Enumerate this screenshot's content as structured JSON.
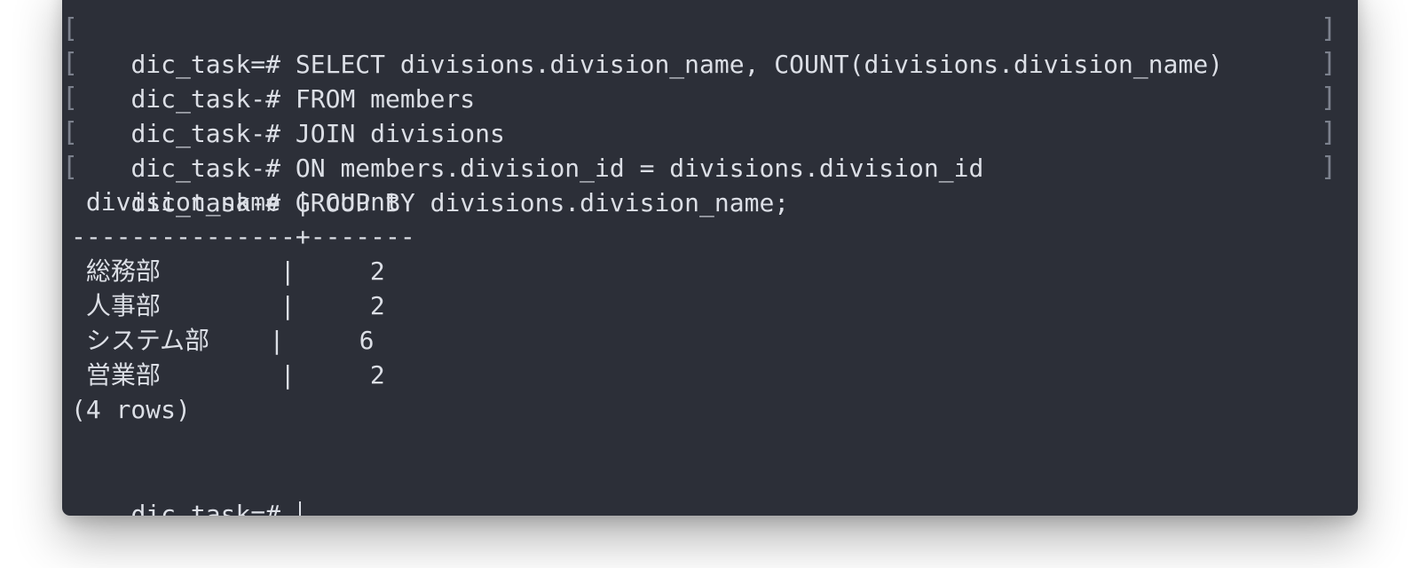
{
  "terminal": {
    "query_lines": [
      "dic_task=# SELECT divisions.division_name, COUNT(divisions.division_name)",
      "dic_task-# FROM members",
      "dic_task-# JOIN divisions",
      "dic_task-# ON members.division_id = divisions.division_id",
      "dic_task-# GROUP BY divisions.division_name;"
    ],
    "result_header": " division_name | count",
    "result_separator": "---------------+-------",
    "result_rows": [
      " 総務部        |     2",
      " 人事部        |     2",
      " システム部    |     6",
      " 営業部        |     2"
    ],
    "row_count": "(4 rows)",
    "prompt": "dic_task=# "
  },
  "colors": {
    "terminal_background": "#2c2f38",
    "text": "#dcdfe6",
    "bracket": "#7c818d"
  }
}
